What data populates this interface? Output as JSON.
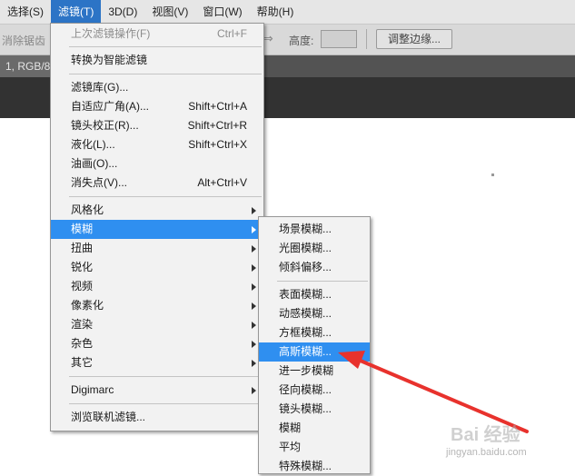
{
  "menubar": {
    "items": [
      {
        "label": "选择(S)"
      },
      {
        "label": "滤镜(T)",
        "active": true
      },
      {
        "label": "3D(D)"
      },
      {
        "label": "视图(V)"
      },
      {
        "label": "窗口(W)"
      },
      {
        "label": "帮助(H)"
      }
    ]
  },
  "options_bar": {
    "antialias_label": "消除锯齿",
    "arrow_glyph": "⇒",
    "height_label": "高度:",
    "height_value": "",
    "refine_edge_label": "调整边缘..."
  },
  "document_tab": {
    "label": "1, RGB/8*"
  },
  "filter_menu": {
    "items": [
      {
        "label": "上次滤镜操作(F)",
        "shortcut": "Ctrl+F",
        "disabled": true
      },
      {
        "label": "转换为智能滤镜"
      },
      {
        "label": "滤镜库(G)..."
      },
      {
        "label": "自适应广角(A)...",
        "shortcut": "Shift+Ctrl+A"
      },
      {
        "label": "镜头校正(R)...",
        "shortcut": "Shift+Ctrl+R"
      },
      {
        "label": "液化(L)...",
        "shortcut": "Shift+Ctrl+X"
      },
      {
        "label": "油画(O)..."
      },
      {
        "label": "消失点(V)...",
        "shortcut": "Alt+Ctrl+V"
      },
      {
        "label": "风格化",
        "submenu": true
      },
      {
        "label": "模糊",
        "submenu": true,
        "highlighted": true
      },
      {
        "label": "扭曲",
        "submenu": true
      },
      {
        "label": "锐化",
        "submenu": true
      },
      {
        "label": "视频",
        "submenu": true
      },
      {
        "label": "像素化",
        "submenu": true
      },
      {
        "label": "渲染",
        "submenu": true
      },
      {
        "label": "杂色",
        "submenu": true
      },
      {
        "label": "其它",
        "submenu": true
      },
      {
        "label": "Digimarc",
        "submenu": true
      },
      {
        "label": "浏览联机滤镜..."
      }
    ]
  },
  "blur_submenu": {
    "items": [
      {
        "label": "场景模糊..."
      },
      {
        "label": "光圈模糊..."
      },
      {
        "label": "倾斜偏移..."
      },
      {
        "label": "表面模糊..."
      },
      {
        "label": "动感模糊..."
      },
      {
        "label": "方框模糊..."
      },
      {
        "label": "高斯模糊...",
        "highlighted": true
      },
      {
        "label": "进一步模糊"
      },
      {
        "label": "径向模糊..."
      },
      {
        "label": "镜头模糊..."
      },
      {
        "label": "模糊"
      },
      {
        "label": "平均"
      },
      {
        "label": "特殊模糊..."
      }
    ]
  },
  "annotation": {
    "arrow_color": "#e8322d"
  },
  "watermark": {
    "brand": "Bai 经验",
    "url": "jingyan.baidu.com"
  },
  "colors": {
    "menu_highlight": "#2f8ff0",
    "menubar_active": "#2c74c6"
  }
}
